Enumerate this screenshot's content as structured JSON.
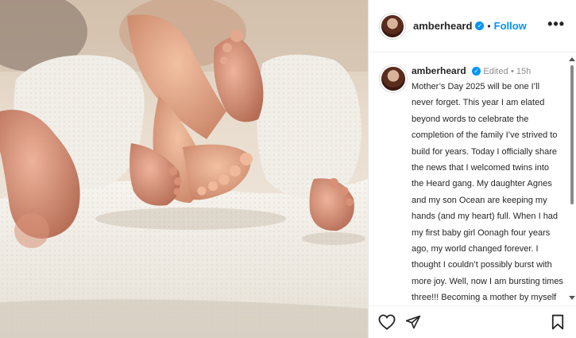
{
  "post": {
    "username": "amberheard",
    "verified": true,
    "follow_label": "Follow",
    "more_label": "•••",
    "caption_username": "amberheard",
    "edited_label": "Edited",
    "time_label": "15h",
    "caption": "Mother’s Day 2025 will be one I’ll never forget. This year I am elated beyond words to celebrate the completion of the family I’ve strived to build for years. Today I officially share the news that I welcomed twins into the Heard gang. My daughter Agnes and my son Ocean are keeping my hands (and my heart) full. When I had my first baby girl Oonagh four years ago, my world changed forever. I thought I couldn’t possibly burst with more joy. Well, now I am bursting times three!!! Becoming a mother by myself and on my own terms"
  },
  "icons": {
    "like": "heart-icon",
    "share": "paper-plane-icon",
    "save": "bookmark-icon",
    "verified": "verified-badge-icon",
    "more": "more-options-icon"
  },
  "colors": {
    "link_blue": "#0095f6",
    "text": "#262626",
    "muted": "#8e8e8e"
  }
}
